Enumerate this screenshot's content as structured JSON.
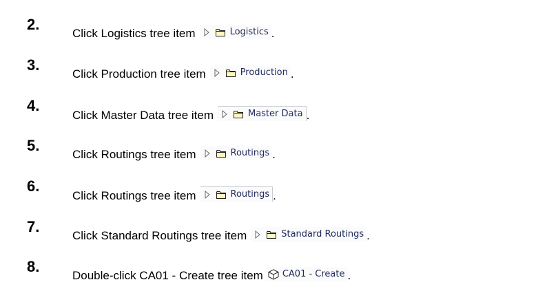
{
  "steps": [
    {
      "number": "2.",
      "text": "Click Logistics tree item",
      "item_label": "Logistics",
      "icon": "folder-icon",
      "trailing": "."
    },
    {
      "number": "3.",
      "text": "Click Production tree item",
      "item_label": "Production",
      "icon": "folder-icon",
      "trailing": "."
    },
    {
      "number": "4.",
      "text": "Click Master Data tree item",
      "item_label": "Master Data",
      "icon": "folder-icon",
      "trailing": "."
    },
    {
      "number": "5.",
      "text": "Click Routings tree item",
      "item_label": "Routings",
      "icon": "folder-icon",
      "trailing": "."
    },
    {
      "number": "6.",
      "text": "Click Routings tree item",
      "item_label": "Routings",
      "icon": "folder-icon",
      "trailing": "."
    },
    {
      "number": "7.",
      "text": "Click Standard Routings tree item",
      "item_label": "Standard Routings",
      "icon": "folder-icon",
      "trailing": "."
    },
    {
      "number": "8.",
      "text": "Double-click CA01 - Create tree item",
      "item_label": "CA01 - Create",
      "icon": "transaction-cube-icon",
      "trailing": "."
    }
  ],
  "colors": {
    "item_text": "#1f2a5a",
    "chip_background": "#fbfbfb",
    "folder_fill": "#fff7c0",
    "icon_outline": "#222222"
  }
}
